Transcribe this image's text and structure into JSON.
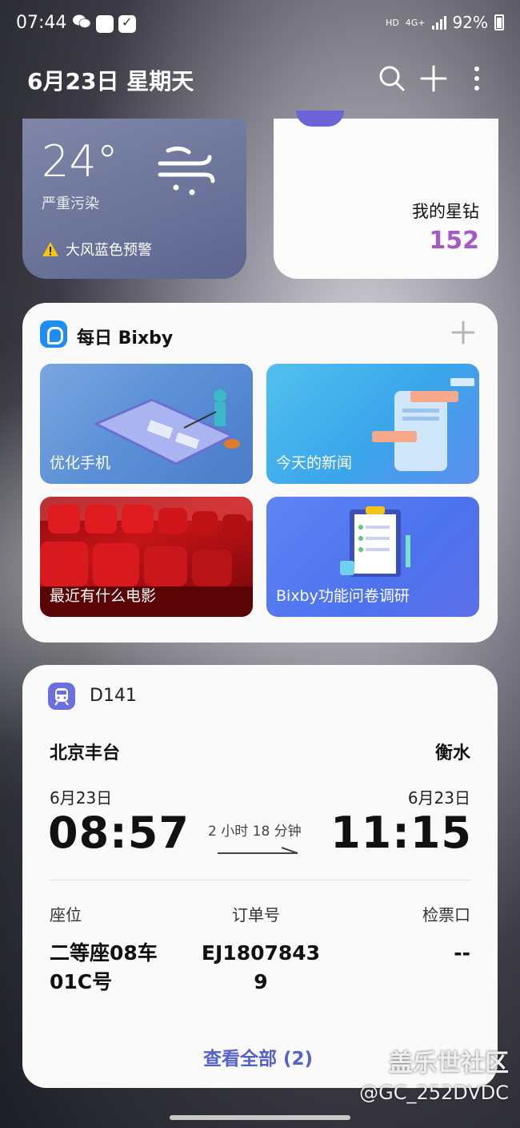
{
  "status_bar": {
    "time": "07:44",
    "network_hd": "HD",
    "network_type": "4G+",
    "battery": "92%"
  },
  "header": {
    "date": "6月23日 星期天"
  },
  "weather": {
    "temperature": "24°",
    "air_quality": "严重污染",
    "alert": "大风蓝色预警"
  },
  "stars": {
    "label": "我的星钻",
    "value": "152"
  },
  "bixby": {
    "title": "每日 Bixby",
    "tiles": [
      {
        "label": "优化手机"
      },
      {
        "label": "今天的新闻"
      },
      {
        "label": "最近有什么电影"
      },
      {
        "label": "Bixby功能问卷调研"
      }
    ]
  },
  "train": {
    "number": "D141",
    "from_station": "北京丰台",
    "to_station": "衡水",
    "from_date": "6月23日",
    "to_date": "6月23日",
    "departure_time": "08:57",
    "arrival_time": "11:15",
    "duration": "2 小时 18 分钟",
    "seat_label": "座位",
    "order_label": "订单号",
    "gate_label": "检票口",
    "seat_line1": "二等座08车",
    "seat_line2": "01C号",
    "order_line1": "EJ1807843",
    "order_line2": "9",
    "gate_value": "--",
    "view_all": "查看全部 (2)"
  },
  "watermark": {
    "line1": "盖乐世社区",
    "line2": "@GC_252DVDC"
  }
}
